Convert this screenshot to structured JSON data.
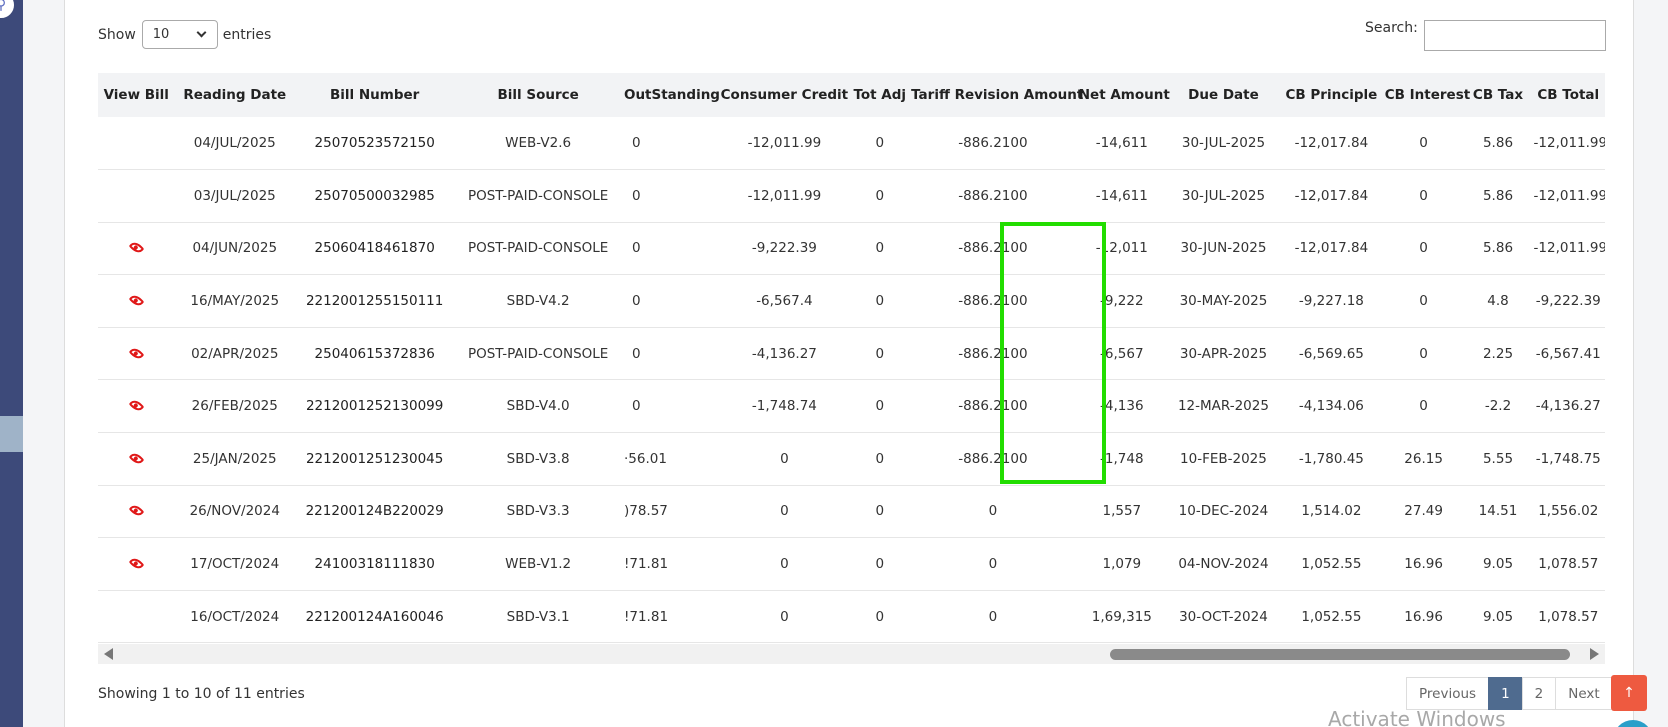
{
  "controls": {
    "show_label": "Show",
    "length_value": "10",
    "entries_label": "entries",
    "search_label": "Search:",
    "search_value": ""
  },
  "table": {
    "headers": [
      "View Bill",
      "Reading Date",
      "Bill Number",
      "Bill Source",
      "OutStanding",
      "Consumer Credit",
      "Tot Adj",
      "Tariff Revision Amount",
      "Net Amount",
      "Due Date",
      "CB Principle",
      "CB Interest",
      "CB Tax",
      "CB Total"
    ],
    "rows": [
      {
        "view": false,
        "reading_date": "04/JUL/2025",
        "bill_number": "25070523572150",
        "bill_source": "WEB-V2.6",
        "outstanding": "0",
        "consumer_credit": "-12,011.99",
        "tot_adj": "0",
        "tariff_revision": "-886.2100",
        "net_amount": "-14,611",
        "due_date": "30-JUL-2025",
        "cb_principle": "-12,017.84",
        "cb_interest": "0",
        "cb_tax": "5.86",
        "cb_total": "-12,011.99"
      },
      {
        "view": false,
        "reading_date": "03/JUL/2025",
        "bill_number": "25070500032985",
        "bill_source": "POST-PAID-CONSOLE",
        "outstanding": "0",
        "consumer_credit": "-12,011.99",
        "tot_adj": "0",
        "tariff_revision": "-886.2100",
        "net_amount": "-14,611",
        "due_date": "30-JUL-2025",
        "cb_principle": "-12,017.84",
        "cb_interest": "0",
        "cb_tax": "5.86",
        "cb_total": "-12,011.99"
      },
      {
        "view": true,
        "reading_date": "04/JUN/2025",
        "bill_number": "25060418461870",
        "bill_source": "POST-PAID-CONSOLE",
        "outstanding": "0",
        "consumer_credit": "-9,222.39",
        "tot_adj": "0",
        "tariff_revision": "-886.2100",
        "net_amount": "-12,011",
        "due_date": "30-JUN-2025",
        "cb_principle": "-12,017.84",
        "cb_interest": "0",
        "cb_tax": "5.86",
        "cb_total": "-12,011.99"
      },
      {
        "view": true,
        "reading_date": "16/MAY/2025",
        "bill_number": "2212001255150111",
        "bill_source": "SBD-V4.2",
        "outstanding": "0",
        "consumer_credit": "-6,567.4",
        "tot_adj": "0",
        "tariff_revision": "-886.2100",
        "net_amount": "-9,222",
        "due_date": "30-MAY-2025",
        "cb_principle": "-9,227.18",
        "cb_interest": "0",
        "cb_tax": "4.8",
        "cb_total": "-9,222.39"
      },
      {
        "view": true,
        "reading_date": "02/APR/2025",
        "bill_number": "25040615372836",
        "bill_source": "POST-PAID-CONSOLE",
        "outstanding": "0",
        "consumer_credit": "-4,136.27",
        "tot_adj": "0",
        "tariff_revision": "-886.2100",
        "net_amount": "-6,567",
        "due_date": "30-APR-2025",
        "cb_principle": "-6,569.65",
        "cb_interest": "0",
        "cb_tax": "2.25",
        "cb_total": "-6,567.41"
      },
      {
        "view": true,
        "reading_date": "26/FEB/2025",
        "bill_number": "2212001252130099",
        "bill_source": "SBD-V4.0",
        "outstanding": "0",
        "consumer_credit": "-1,748.74",
        "tot_adj": "0",
        "tariff_revision": "-886.2100",
        "net_amount": "-4,136",
        "due_date": "12-MAR-2025",
        "cb_principle": "-4,134.06",
        "cb_interest": "0",
        "cb_tax": "-2.2",
        "cb_total": "-4,136.27"
      },
      {
        "view": true,
        "reading_date": "25/JAN/2025",
        "bill_number": "2212001251230045",
        "bill_source": "SBD-V3.8",
        "outstanding": "·56.01",
        "consumer_credit": "0",
        "tot_adj": "0",
        "tariff_revision": "-886.2100",
        "net_amount": "-1,748",
        "due_date": "10-FEB-2025",
        "cb_principle": "-1,780.45",
        "cb_interest": "26.15",
        "cb_tax": "5.55",
        "cb_total": "-1,748.75"
      },
      {
        "view": true,
        "reading_date": "26/NOV/2024",
        "bill_number": "221200124B220029",
        "bill_source": "SBD-V3.3",
        "outstanding": ")78.57",
        "consumer_credit": "0",
        "tot_adj": "0",
        "tariff_revision": "0",
        "net_amount": "1,557",
        "due_date": "10-DEC-2024",
        "cb_principle": "1,514.02",
        "cb_interest": "27.49",
        "cb_tax": "14.51",
        "cb_total": "1,556.02"
      },
      {
        "view": true,
        "reading_date": "17/OCT/2024",
        "bill_number": "24100318111830",
        "bill_source": "WEB-V1.2",
        "outstanding": "!71.81",
        "consumer_credit": "0",
        "tot_adj": "0",
        "tariff_revision": "0",
        "net_amount": "1,079",
        "due_date": "04-NOV-2024",
        "cb_principle": "1,052.55",
        "cb_interest": "16.96",
        "cb_tax": "9.05",
        "cb_total": "1,078.57"
      },
      {
        "view": false,
        "reading_date": "16/OCT/2024",
        "bill_number": "221200124A160046",
        "bill_source": "SBD-V3.1",
        "outstanding": "!71.81",
        "consumer_credit": "0",
        "tot_adj": "0",
        "tariff_revision": "0",
        "net_amount": "1,69,315",
        "due_date": "30-OCT-2024",
        "cb_principle": "1,052.55",
        "cb_interest": "16.96",
        "cb_tax": "9.05",
        "cb_total": "1,078.57"
      }
    ]
  },
  "footer": {
    "info": "Showing 1 to 10 of 11 entries",
    "previous": "Previous",
    "pages": [
      "1",
      "2"
    ],
    "active_page": "1",
    "next": "Next",
    "watermark": "Activate Windows"
  },
  "icons": {
    "view": "eye-icon",
    "scroll_top": "arrow-up-icon",
    "search": "search-icon"
  },
  "colors": {
    "highlight_border": "#22dd00",
    "view_icon": "#e01818",
    "active_page": "#4f6b8f",
    "top_button": "#ee5a40"
  }
}
